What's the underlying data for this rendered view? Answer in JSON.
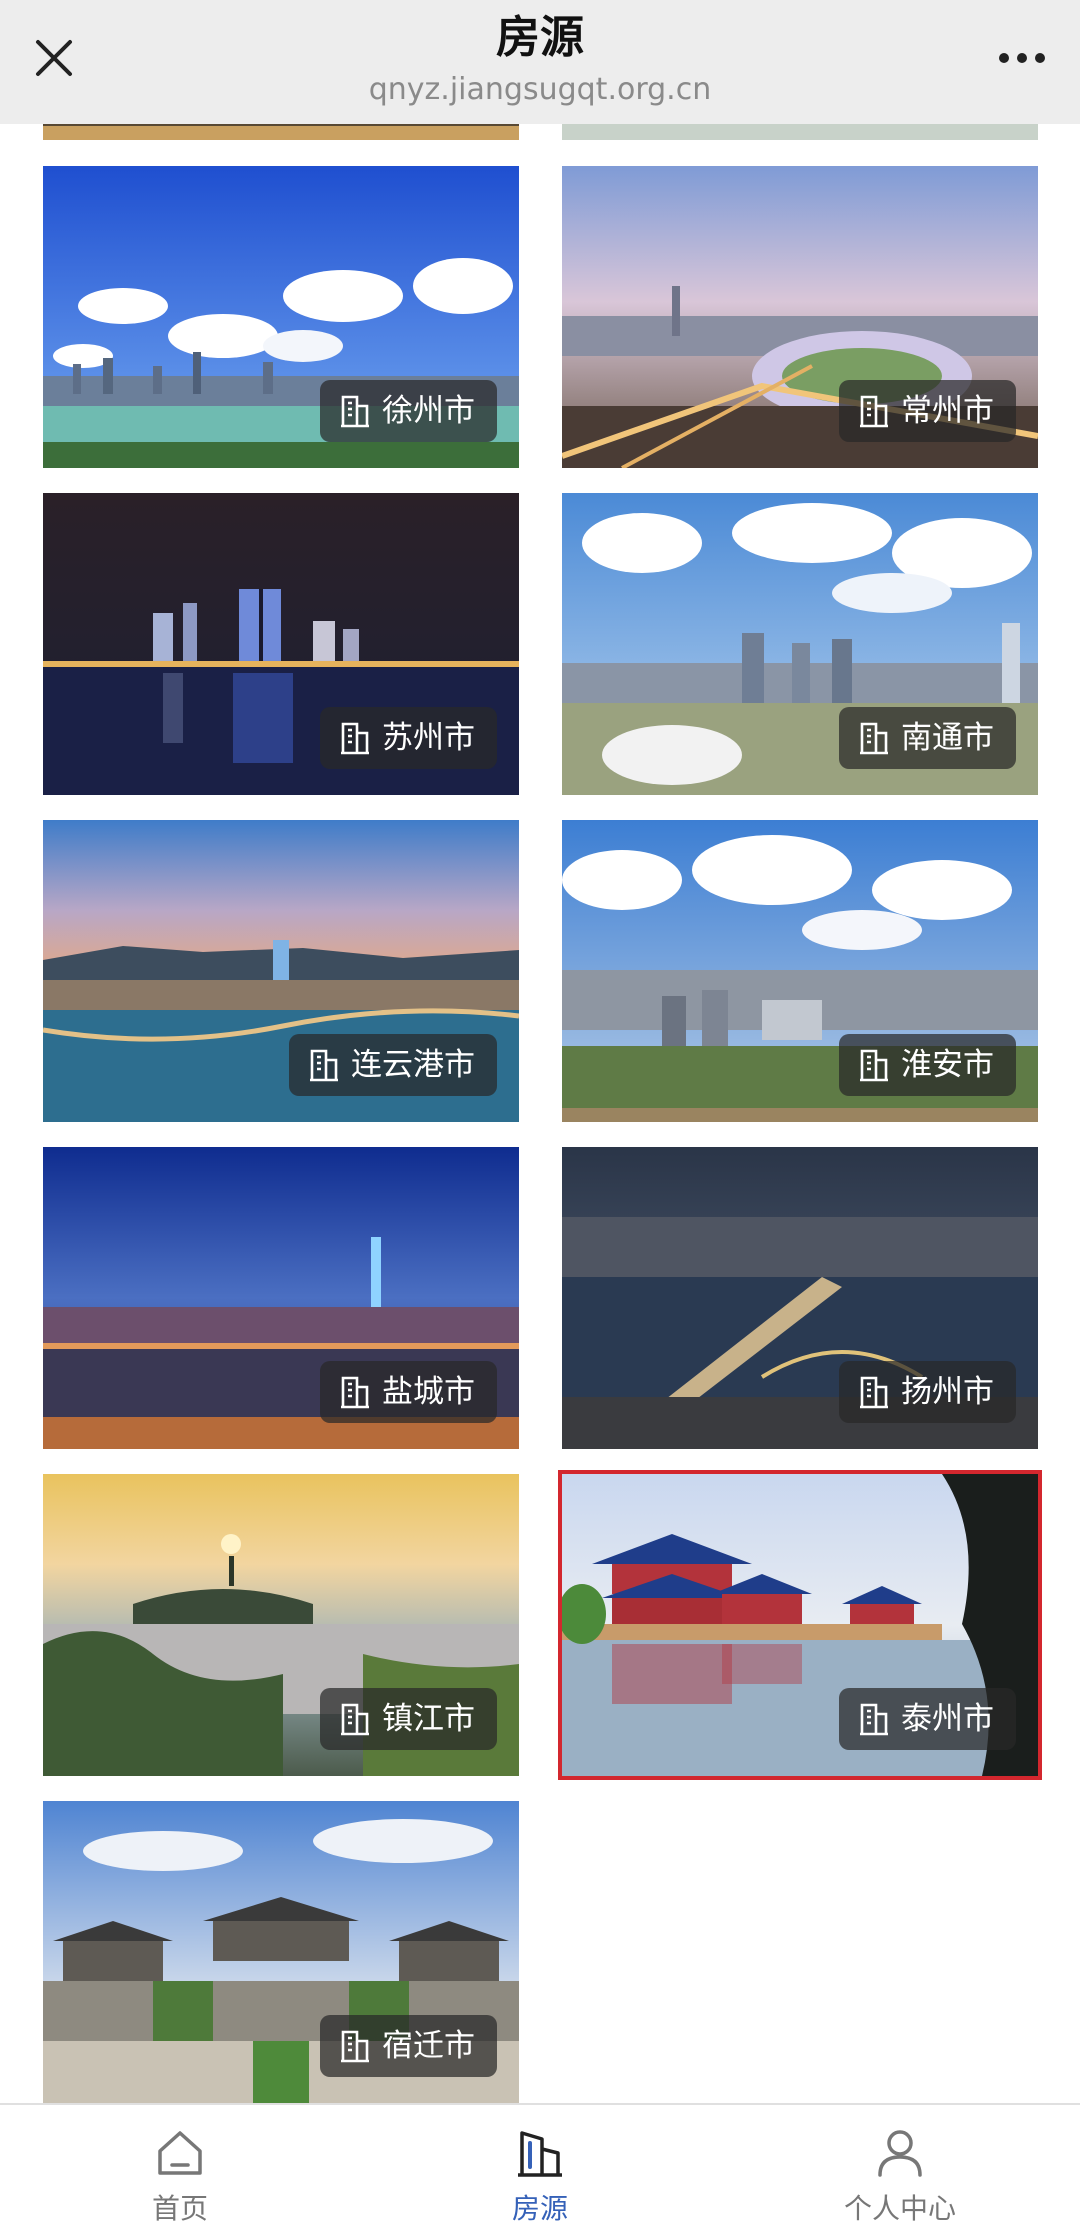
{
  "header": {
    "title": "房源",
    "domain": "qnyz.jiangsugqt.org.cn"
  },
  "cities": [
    {
      "name": "徐州市"
    },
    {
      "name": "常州市"
    },
    {
      "name": "苏州市"
    },
    {
      "name": "南通市"
    },
    {
      "name": "连云港市"
    },
    {
      "name": "淮安市"
    },
    {
      "name": "盐城市"
    },
    {
      "name": "扬州市"
    },
    {
      "name": "镇江市"
    },
    {
      "name": "泰州市",
      "selected": true
    },
    {
      "name": "宿迁市"
    }
  ],
  "bottom_nav": [
    {
      "label": "首页",
      "icon": "home-icon"
    },
    {
      "label": "房源",
      "icon": "building-icon",
      "active": true
    },
    {
      "label": "个人中心",
      "icon": "person-icon"
    }
  ],
  "colors": {
    "selected_outline": "#d3272e",
    "active_nav": "#3561b8"
  }
}
